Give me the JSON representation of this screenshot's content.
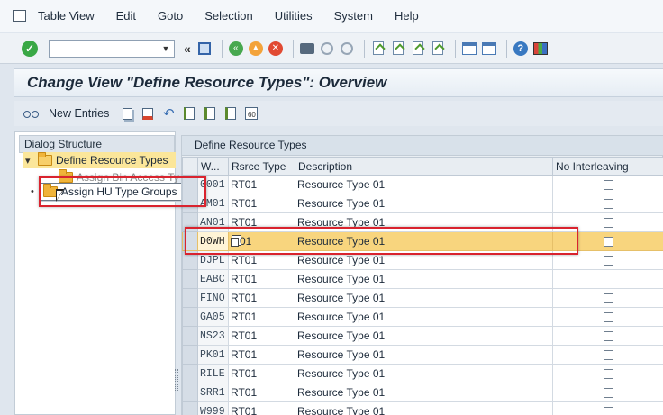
{
  "menu": {
    "items": [
      {
        "label": "Table View"
      },
      {
        "label": "Edit"
      },
      {
        "label": "Goto"
      },
      {
        "label": "Selection"
      },
      {
        "label": "Utilities"
      },
      {
        "label": "System"
      },
      {
        "label": "Help"
      }
    ]
  },
  "toolbar": {
    "command_value": "",
    "icons": [
      "enter-icon",
      "save-icon",
      "back-icon",
      "exit-icon",
      "cancel-icon",
      "print-icon",
      "find-icon",
      "find-next-icon",
      "first-page-icon",
      "previous-page-icon",
      "next-page-icon",
      "last-page-icon",
      "create-session-icon",
      "shortcut-icon",
      "help-icon",
      "customize-layout-icon"
    ]
  },
  "title": "Change View \"Define Resource Types\": Overview",
  "app_toolbar": {
    "new_entries_label": "New Entries"
  },
  "dialog_structure": {
    "header": "Dialog Structure",
    "root": "Define Resource Types",
    "children": [
      "Assign Bin Access Ty",
      "Assign HU Type Groups"
    ]
  },
  "table": {
    "title": "Define Resource Types",
    "columns": [
      "W...",
      "Rsrce Type",
      "Description",
      "No Interleaving"
    ],
    "rows": [
      {
        "w": "0001",
        "type": "RT01",
        "desc": "Resource Type 01"
      },
      {
        "w": "AM01",
        "type": "RT01",
        "desc": "Resource Type 01"
      },
      {
        "w": "AN01",
        "type": "RT01",
        "desc": "Resource Type 01"
      },
      {
        "w": "D0WH",
        "type": "01",
        "desc": "Resource Type 01"
      },
      {
        "w": "DJPL",
        "type": "RT01",
        "desc": "Resource Type 01"
      },
      {
        "w": "EABC",
        "type": "RT01",
        "desc": "Resource Type 01"
      },
      {
        "w": "FINO",
        "type": "RT01",
        "desc": "Resource Type 01"
      },
      {
        "w": "GA05",
        "type": "RT01",
        "desc": "Resource Type 01"
      },
      {
        "w": "NS23",
        "type": "RT01",
        "desc": "Resource Type 01"
      },
      {
        "w": "PK01",
        "type": "RT01",
        "desc": "Resource Type 01"
      },
      {
        "w": "RILE",
        "type": "RT01",
        "desc": "Resource Type 01"
      },
      {
        "w": "SRR1",
        "type": "RT01",
        "desc": "Resource Type 01"
      },
      {
        "w": "W999",
        "type": "RT01",
        "desc": "Resource Type 01"
      }
    ]
  },
  "colors": {
    "highlight_row": "#f8d57e",
    "annotation_red": "#d9232e",
    "tree_selected": "#fbe69a"
  }
}
